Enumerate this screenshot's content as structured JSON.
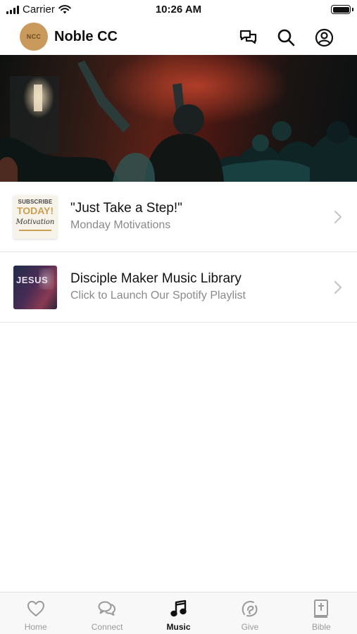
{
  "status_bar": {
    "carrier": "Carrier",
    "time": "10:26 AM"
  },
  "header": {
    "logo_text": "NCC",
    "title": "Noble CC",
    "icons": [
      "chat-icon",
      "search-icon",
      "profile-icon"
    ]
  },
  "hero": {
    "image": "worship-concert-photo"
  },
  "list": {
    "items": [
      {
        "title": "\"Just Take a Step!\"",
        "subtitle": "Monday Motivations",
        "thumb": {
          "line1": "SUBSCRIBE",
          "line2": "TODAY!",
          "line3": "Motivation"
        }
      },
      {
        "title": "Disciple Maker Music Library",
        "subtitle": "Click to Launch Our Spotify Playlist",
        "thumb": {
          "line1": "JESUS"
        }
      }
    ]
  },
  "tabs": [
    {
      "label": "Home",
      "icon": "heart-icon",
      "active": false
    },
    {
      "label": "Connect",
      "icon": "chat-bubbles-icon",
      "active": false
    },
    {
      "label": "Music",
      "icon": "music-note-icon",
      "active": true
    },
    {
      "label": "Give",
      "icon": "give-icon",
      "active": false
    },
    {
      "label": "Bible",
      "icon": "bible-icon",
      "active": false
    }
  ],
  "colors": {
    "logo": "#c99a5c",
    "active_tab": "#111111",
    "inactive_tab": "#9a9a9a",
    "subtitle": "#8a8a8a"
  }
}
